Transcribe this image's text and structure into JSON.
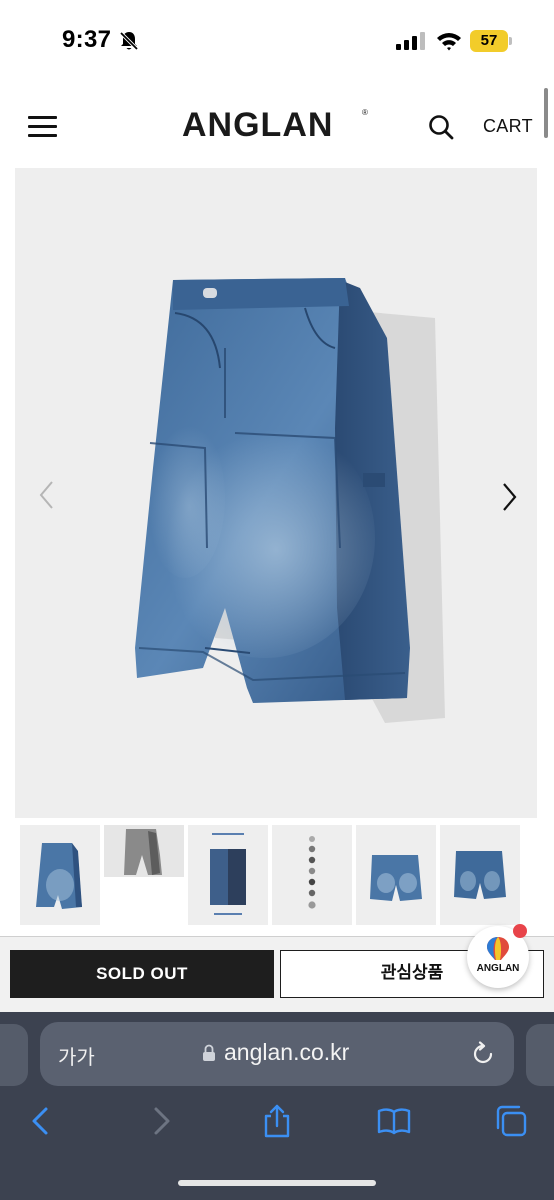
{
  "status_bar": {
    "time": "9:37",
    "battery": "57",
    "icons": [
      "bell-slash-icon",
      "signal-icon",
      "wifi-icon",
      "battery-icon"
    ]
  },
  "header": {
    "logo": "ANGLAN",
    "logo_mark": "®",
    "cart_label": "CART",
    "icons": [
      "menu-icon",
      "search-icon"
    ]
  },
  "gallery": {
    "icons": [
      "chevron-left-icon",
      "chevron-right-icon"
    ],
    "thumbnail_count": 6
  },
  "actions": {
    "sold_out_label": "SOLD OUT",
    "wishlist_label": "관심상품",
    "badge_text": "ANGLAN"
  },
  "browser": {
    "text_size_label": "가가",
    "url": "anglan.co.kr",
    "icons": [
      "lock-icon",
      "reload-icon",
      "back-icon",
      "forward-icon",
      "share-icon",
      "bookmarks-icon",
      "tabs-icon"
    ]
  },
  "colors": {
    "accent_dark": "#1e1e1e",
    "battery": "#f2cc2a",
    "denim": "#3d6796",
    "badge_dot": "#e8444a",
    "browser_bar": "#3c4250",
    "link_blue": "#3b8ff3"
  }
}
